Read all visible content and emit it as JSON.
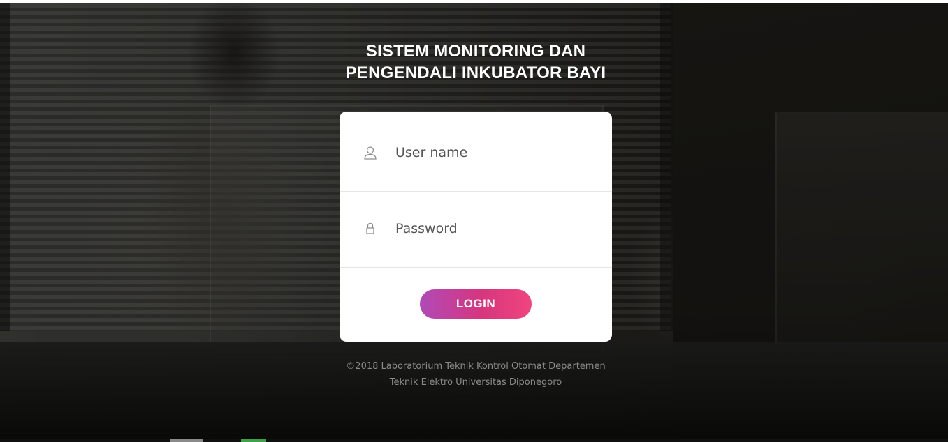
{
  "page": {
    "title_line1": "SISTEM MONITORING DAN",
    "title_line2": "PENGENDALI INKUBATOR BAYI"
  },
  "login_form": {
    "username": {
      "icon": "user-icon",
      "placeholder": "User name",
      "value": ""
    },
    "password": {
      "icon": "lock-icon",
      "placeholder": "Password",
      "value": ""
    },
    "login_button": "LOGIN",
    "button_gradient": [
      "#b04ab8",
      "#d6367e",
      "#f0457f"
    ]
  },
  "footer": {
    "line1": "©2018 Laboratorium Teknik Kontrol Otomat Departemen",
    "line2": "Teknik Elektro Universitas Diponegoro"
  },
  "background": {
    "description_icon": "background-photo"
  }
}
